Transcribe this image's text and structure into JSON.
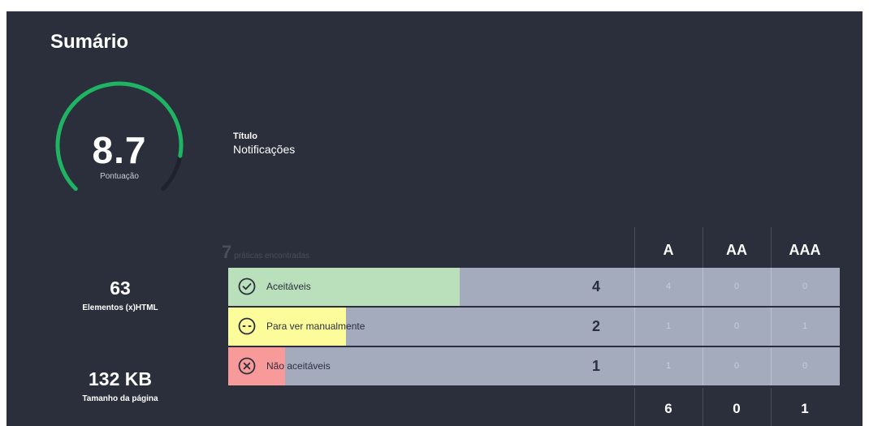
{
  "summary": {
    "title": "Sumário",
    "score": "8.7",
    "score_fraction": 0.87,
    "score_label": "Pontuação",
    "page_info_label": "Título",
    "page_info_value": "Notificações",
    "elements_count": "63",
    "elements_label": "Elementos (x)HTML",
    "page_size": "132 KB",
    "page_size_label": "Tamanho da página"
  },
  "results": {
    "total": "7",
    "total_suffix": "práticas encontradas",
    "levels": [
      "A",
      "AA",
      "AAA"
    ],
    "rows": [
      {
        "label": "Aceitáveis",
        "count": "4",
        "cells": [
          "4",
          "0",
          "0"
        ],
        "icon": "check-circle-icon",
        "color": "#b9dfbb",
        "fill_fraction": 0.57
      },
      {
        "label": "Para ver manualmente",
        "count": "2",
        "cells": [
          "1",
          "0",
          "1"
        ],
        "icon": "ellipsis-circle-icon",
        "color": "#fdfc9a",
        "fill_fraction": 0.29
      },
      {
        "label": "Não aceitáveis",
        "count": "1",
        "cells": [
          "1",
          "0",
          "0"
        ],
        "icon": "x-circle-icon",
        "color": "#f89a99",
        "fill_fraction": 0.14
      }
    ],
    "totals": [
      "6",
      "0",
      "1"
    ]
  },
  "colors": {
    "panel": "#2b2f3c",
    "gauge": "#1fb463",
    "track": "#1f222c"
  }
}
